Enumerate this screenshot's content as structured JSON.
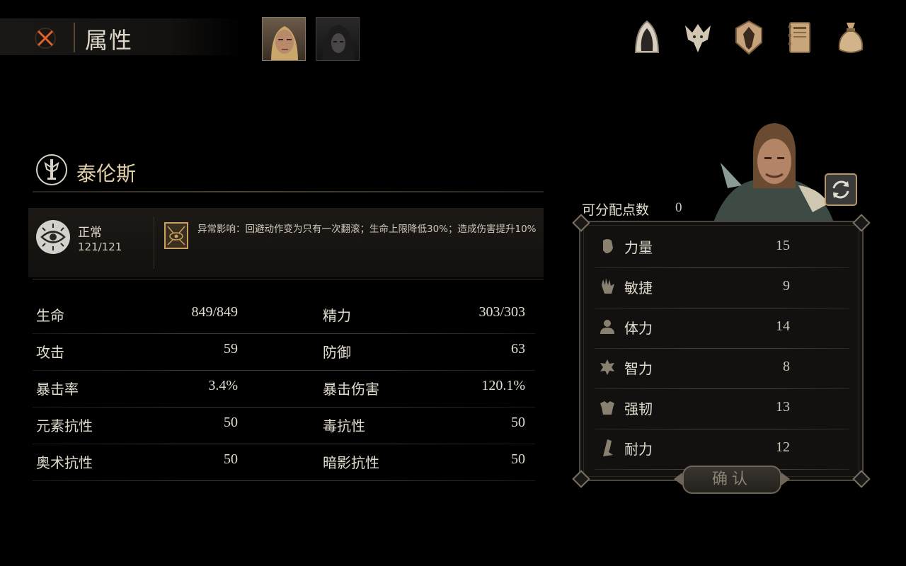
{
  "header": {
    "title": "属性",
    "character_tabs": [
      {
        "name": "portrait-blond"
      },
      {
        "name": "portrait-hooded"
      }
    ],
    "nav_icons": [
      "hood-icon",
      "wolf-crest-icon",
      "shield-emblem-icon",
      "journal-icon",
      "pouch-icon"
    ]
  },
  "character": {
    "name": "泰伦斯",
    "status": {
      "label": "正常",
      "hp": "121/121"
    },
    "effect_text": "异常影响：回避动作变为只有一次翻滚；生命上限降低30%；造成伤害提升10%"
  },
  "stats": [
    {
      "left_label": "生命",
      "left_value": "849/849",
      "right_label": "精力",
      "right_value": "303/303"
    },
    {
      "left_label": "攻击",
      "left_value": "59",
      "right_label": "防御",
      "right_value": "63"
    },
    {
      "left_label": "暴击率",
      "left_value": "3.4%",
      "right_label": "暴击伤害",
      "right_value": "120.1%"
    },
    {
      "left_label": "元素抗性",
      "left_value": "50",
      "right_label": "毒抗性",
      "right_value": "50"
    },
    {
      "left_label": "奥术抗性",
      "left_value": "50",
      "right_label": "暗影抗性",
      "right_value": "50"
    }
  ],
  "attributes": {
    "points_label": "可分配点数",
    "points_value": "0",
    "items": [
      {
        "label": "力量",
        "value": "15",
        "icon": "fist-icon"
      },
      {
        "label": "敏捷",
        "value": "9",
        "icon": "hand-icon"
      },
      {
        "label": "体力",
        "value": "14",
        "icon": "torso-icon"
      },
      {
        "label": "智力",
        "value": "8",
        "icon": "mind-icon"
      },
      {
        "label": "强韧",
        "value": "13",
        "icon": "armor-icon"
      },
      {
        "label": "耐力",
        "value": "12",
        "icon": "leg-icon"
      }
    ],
    "confirm_label": "确认"
  },
  "colors": {
    "background": "#000000",
    "name_accent": "#e3cfa8",
    "close_icon": "#e0602a"
  }
}
